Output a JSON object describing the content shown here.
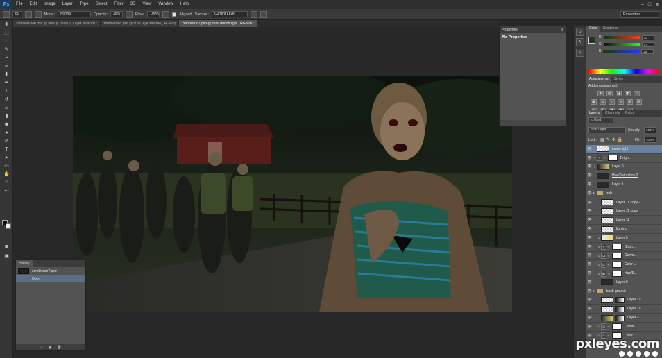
{
  "app": {
    "logo": "Ps"
  },
  "menu": [
    "File",
    "Edit",
    "Image",
    "Layer",
    "Type",
    "Select",
    "Filter",
    "3D",
    "View",
    "Window",
    "Help"
  ],
  "window_controls": [
    "–",
    "□",
    "✕"
  ],
  "options_bar": {
    "brush_size": "80",
    "mode_label": "Mode:",
    "mode_value": "Normal",
    "opacity_label": "Opacity:",
    "opacity_value": "38%",
    "flow_label": "Flow:",
    "flow_value": "100%",
    "aligned_label": "Aligned",
    "sample_label": "Sample:",
    "sample_value": "Current Layer",
    "workspace": "Essentials"
  },
  "doc_tabs": [
    {
      "label": "zombierun8b.psd @ 50% (Curves 1, Layer Mask/8) *",
      "active": false
    },
    {
      "label": "zombierun8.psd @ 50% (eye shadow), RGB/8)",
      "active": false
    },
    {
      "label": "zombierun7.psd @ 50% (moon light , RGB/8) *",
      "active": true
    }
  ],
  "history": {
    "tab": "History",
    "snapshot": "zombierun7.psd",
    "steps": [
      "Open"
    ],
    "footer_icons": [
      "⚇",
      "▣",
      "🗑"
    ]
  },
  "properties": {
    "tab": "Properties",
    "message": "No Properties"
  },
  "color_panel": {
    "tabs": [
      "Color",
      "Swatches"
    ],
    "r": {
      "label": "R",
      "value": "30"
    },
    "g": {
      "label": "G",
      "value": "57"
    },
    "b": {
      "label": "B",
      "value": "28"
    },
    "fg_color": "#1e391c"
  },
  "adjustments": {
    "tabs": [
      "Adjustments",
      "Styles"
    ],
    "title": "Add an adjustment",
    "icons_row1": [
      "☀",
      "▤",
      "◪",
      "◩",
      "▽"
    ],
    "icons_row2": [
      "▦",
      "⚖",
      "◐",
      "◑",
      "▧",
      "▨"
    ],
    "icons_row3": [
      "◫",
      "◧",
      "◨",
      "▩",
      "▪"
    ]
  },
  "layers_panel": {
    "tabs": [
      "Layers",
      "Channels",
      "Paths"
    ],
    "kind_label": "Kind",
    "blend_mode": "Soft Light",
    "opacity_label": "Opacity:",
    "opacity_value": "100%",
    "lock_label": "Lock:",
    "fill_label": "Fill:",
    "fill_value": "100%",
    "layers": [
      {
        "name": "moon light",
        "type": "pixel",
        "thumb": "check",
        "selected": true
      },
      {
        "name": "Brigh...",
        "type": "adjustment",
        "selected": false
      },
      {
        "name": "Layer 6",
        "type": "pixel-mask",
        "thumb": "check",
        "selected": false
      },
      {
        "name": "Hue/Saturation 2",
        "type": "pixel",
        "thumb": "dark",
        "selected": false
      },
      {
        "name": "Layer 1",
        "type": "pixel",
        "thumb": "dark",
        "selected": false
      },
      {
        "name": "zub",
        "type": "group",
        "selected": false
      },
      {
        "name": "Layer 11 copy 2",
        "type": "pixel",
        "thumb": "check",
        "selected": false
      },
      {
        "name": "Layer 11 copy",
        "type": "pixel",
        "thumb": "check",
        "selected": false
      },
      {
        "name": "Layer 11",
        "type": "pixel",
        "thumb": "check",
        "selected": false
      },
      {
        "name": "lighting",
        "type": "pixel",
        "thumb": "check",
        "selected": false
      },
      {
        "name": "Layer 5",
        "type": "pixel-mask",
        "thumb": "check",
        "selected": false
      },
      {
        "name": "Brigh...",
        "type": "adjustment",
        "selected": false
      },
      {
        "name": "Curve...",
        "type": "adjustment",
        "selected": false
      },
      {
        "name": "Color ...",
        "type": "adjustment",
        "selected": false
      },
      {
        "name": "Hue/S...",
        "type": "adjustment",
        "selected": false
      },
      {
        "name": "Layer 0",
        "type": "pixel",
        "thumb": "dark",
        "selected": false
      },
      {
        "name": "back ground",
        "type": "group",
        "selected": false
      },
      {
        "name": "Layer 10 ...",
        "type": "pixel-mask",
        "thumb": "check",
        "selected": false
      },
      {
        "name": "Layer 10",
        "type": "pixel-mask",
        "thumb": "check",
        "selected": false
      },
      {
        "name": "Layer 3",
        "type": "pixel-mask",
        "thumb": "check",
        "selected": false
      },
      {
        "name": "Curve...",
        "type": "adjustment",
        "selected": false
      },
      {
        "name": "Color ...",
        "type": "adjustment",
        "selected": false
      }
    ]
  },
  "watermark": "pxleyes.com"
}
